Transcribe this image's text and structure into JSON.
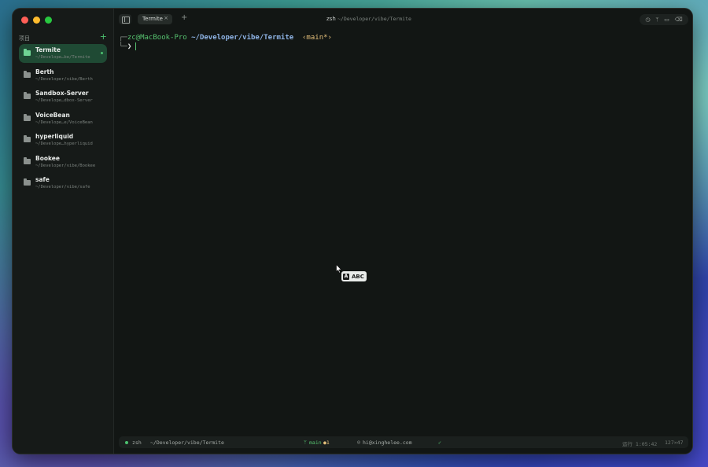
{
  "sidebar": {
    "section_label": "项目",
    "add_label": "+",
    "projects": [
      {
        "name": "Termite",
        "path": "~/Develope…be/Termite",
        "active": true
      },
      {
        "name": "Berth",
        "path": "~/Developer/vibe/Berth"
      },
      {
        "name": "Sandbox-Server",
        "path": "~/Develope…dbox-Server"
      },
      {
        "name": "VoiceBean",
        "path": "~/Develope…e/VoiceBean"
      },
      {
        "name": "hyperliquid",
        "path": "~/Develope…hyperliquid"
      },
      {
        "name": "Bookee",
        "path": "~/Developer/vibe/Bookee"
      },
      {
        "name": "safe",
        "path": "~/Developer/vibe/safe"
      }
    ]
  },
  "toolbar": {
    "tab_label": "Termite",
    "tab_close": "×",
    "add_tab": "+",
    "title_shell": "zsh",
    "title_path": "~/Developer/vibe/Termite",
    "icons": [
      "history-icon",
      "branch-icon",
      "folder-icon",
      "trash-icon"
    ]
  },
  "terminal": {
    "frame_top": "┌─",
    "user_host": "zc@MacBook-Pro",
    "cwd": "~/Developer/vibe/Termite",
    "branch": "‹main*›",
    "frame_bottom": "└─",
    "prompt": "❯"
  },
  "ime": {
    "icon": "A",
    "label": "ABC"
  },
  "statusbar": {
    "shell": "zsh",
    "path": "~/Developer/vibe/Termite",
    "branch_icon": "ᛘ",
    "branch": "main",
    "changes": "●1",
    "user_icon": "☺",
    "user": "hi@xinghelee.com",
    "check": "✓",
    "time": "运行 1:05:42",
    "size": "127×47"
  }
}
